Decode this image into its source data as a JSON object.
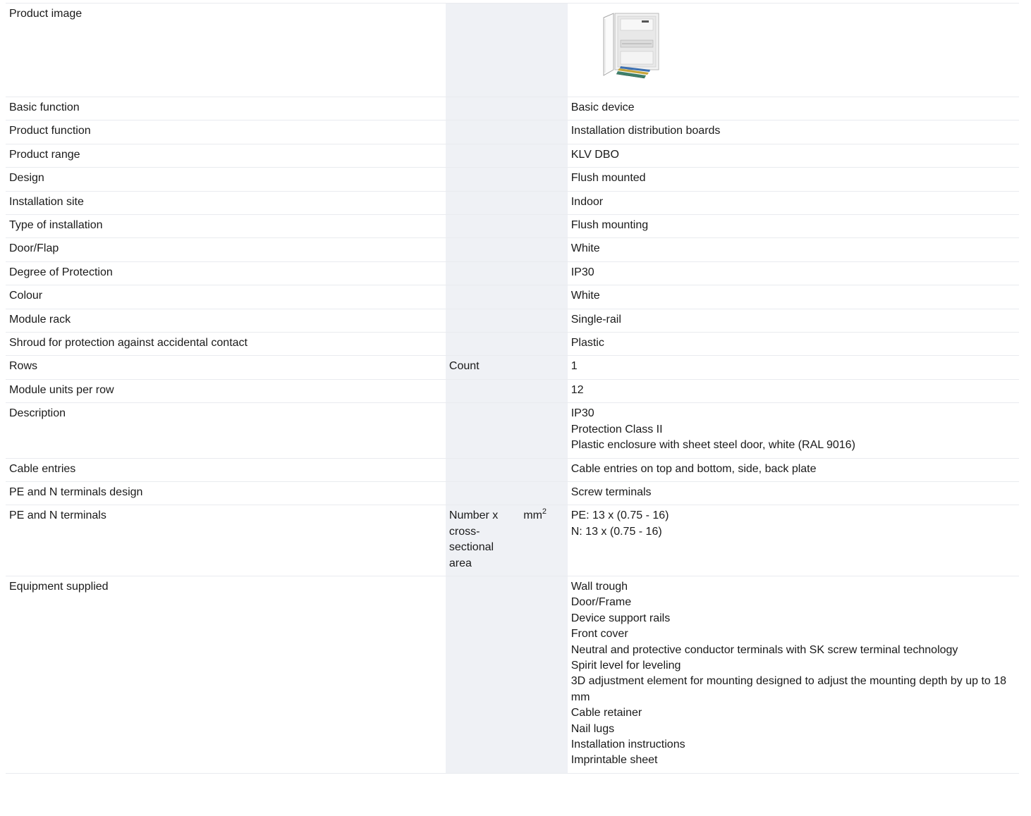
{
  "rows": [
    {
      "name": "Product image",
      "unit": "",
      "unit2": "",
      "value": []
    },
    {
      "name": "Basic function",
      "unit": "",
      "unit2": "",
      "value": [
        "Basic device"
      ]
    },
    {
      "name": "Product function",
      "unit": "",
      "unit2": "",
      "value": [
        "Installation distribution boards"
      ]
    },
    {
      "name": "Product range",
      "unit": "",
      "unit2": "",
      "value": [
        "KLV DBO"
      ]
    },
    {
      "name": "Design",
      "unit": "",
      "unit2": "",
      "value": [
        "Flush mounted"
      ]
    },
    {
      "name": "Installation site",
      "unit": "",
      "unit2": "",
      "value": [
        "Indoor"
      ]
    },
    {
      "name": "Type of installation",
      "unit": "",
      "unit2": "",
      "value": [
        "Flush mounting"
      ]
    },
    {
      "name": "Door/Flap",
      "unit": "",
      "unit2": "",
      "value": [
        "White"
      ]
    },
    {
      "name": "Degree of Protection",
      "unit": "",
      "unit2": "",
      "value": [
        "IP30"
      ]
    },
    {
      "name": "Colour",
      "unit": "",
      "unit2": "",
      "value": [
        "White"
      ]
    },
    {
      "name": "Module rack",
      "unit": "",
      "unit2": "",
      "value": [
        "Single-rail"
      ]
    },
    {
      "name": "Shroud for protection against accidental contact",
      "unit": "",
      "unit2": "",
      "value": [
        "Plastic"
      ]
    },
    {
      "name": "Rows",
      "unit": "Count",
      "unit2": "",
      "value": [
        "1"
      ]
    },
    {
      "name": "Module units per row",
      "unit": "",
      "unit2": "",
      "value": [
        "12"
      ]
    },
    {
      "name": "Description",
      "unit": "",
      "unit2": "",
      "value": [
        "IP30",
        "Protection Class II",
        "Plastic enclosure with sheet steel door, white (RAL 9016)"
      ]
    },
    {
      "name": "Cable entries",
      "unit": "",
      "unit2": "",
      "value": [
        "Cable entries on top and bottom, side, back plate"
      ]
    },
    {
      "name": "PE and N terminals design",
      "unit": "",
      "unit2": "",
      "value": [
        "Screw terminals"
      ]
    },
    {
      "name": "PE and N terminals",
      "unit": "Number x cross-sectional area",
      "unit2": "mm",
      "unit2_sup": "2",
      "value": [
        "PE: 13 x (0.75 - 16)",
        "N: 13 x (0.75 - 16)"
      ]
    },
    {
      "name": "Equipment supplied",
      "unit": "",
      "unit2": "",
      "value": [
        "Wall trough",
        "Door/Frame",
        "Device support rails",
        "Front cover",
        "Neutral and protective conductor terminals with SK screw terminal technology",
        "Spirit level for leveling",
        "3D adjustment element for mounting designed to adjust the mounting depth by up to 18 mm",
        "Cable retainer",
        "Nail lugs",
        "Installation instructions",
        "Imprintable sheet"
      ]
    }
  ]
}
